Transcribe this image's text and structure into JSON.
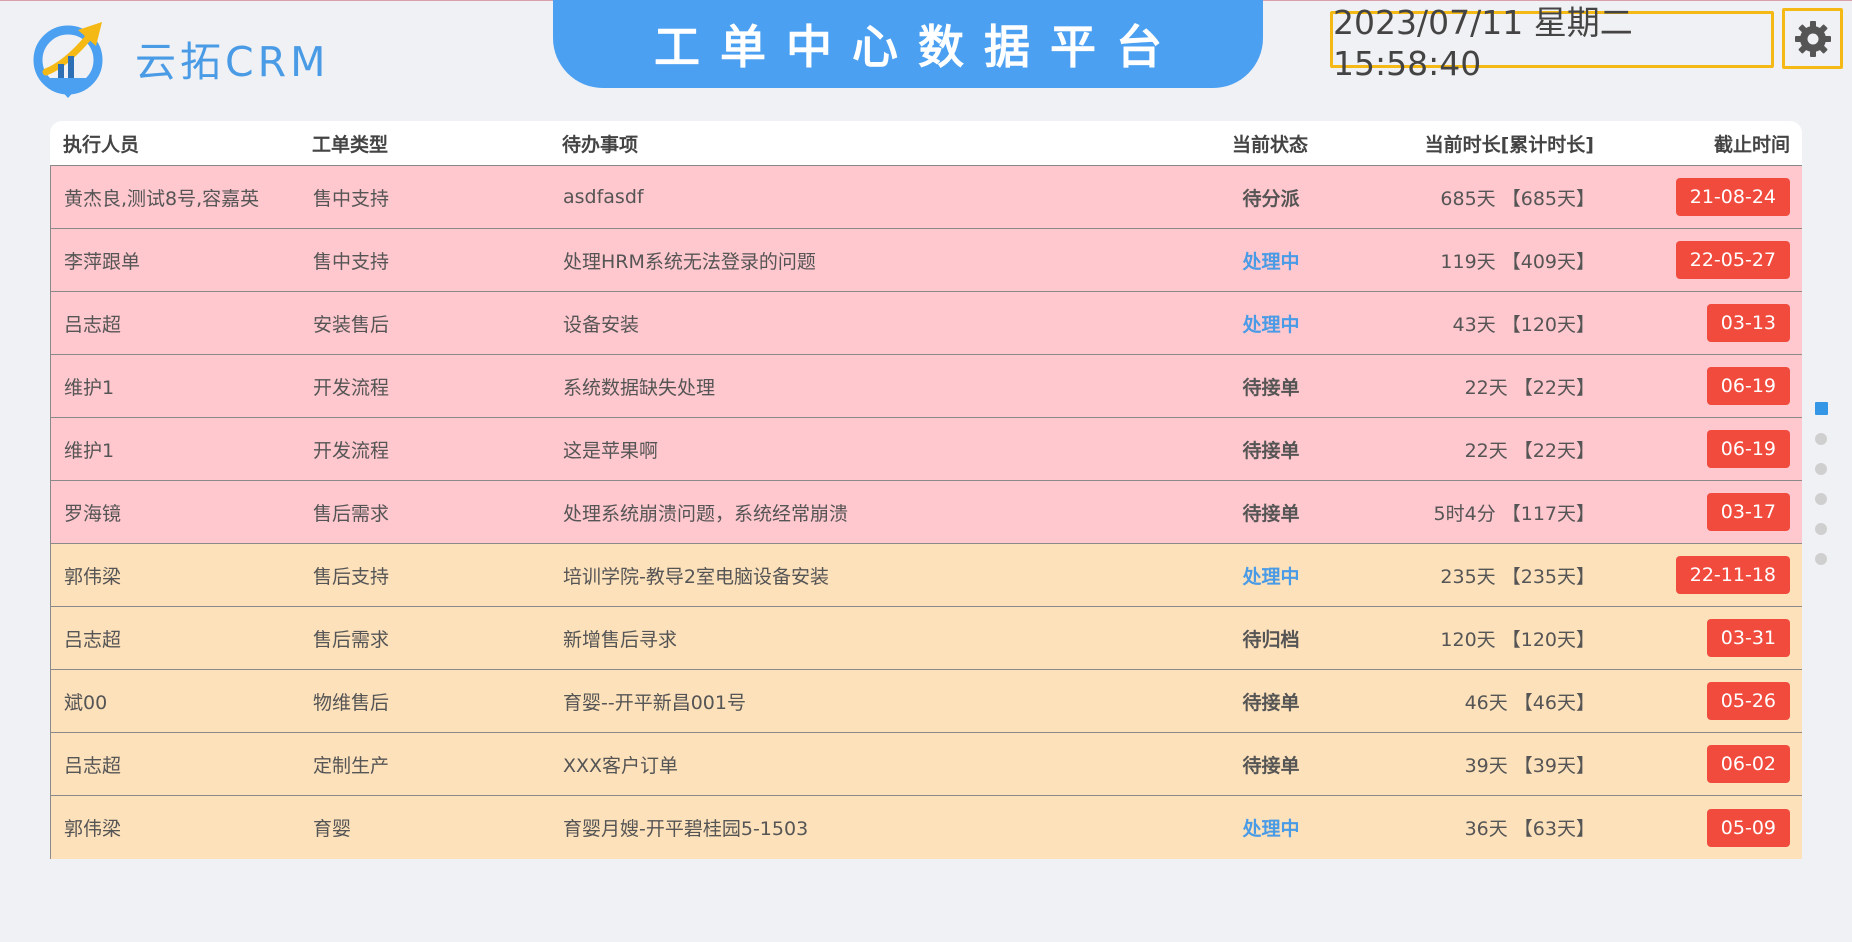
{
  "brand": {
    "name": "云拓CRM"
  },
  "header": {
    "title": "工单中心数据平台",
    "datetime": "2023/07/11 星期二 15:58:40"
  },
  "colors": {
    "accent": "#4ba0f1",
    "clock_border": "#f5b915",
    "row_pink": "#ffc8ce",
    "row_tan": "#fde1bb",
    "deadline_badge": "#f14b3e",
    "status_processing": "#4a9be6"
  },
  "icons": {
    "logo": "rocket-arrow-logo-icon",
    "settings": "gear-icon"
  },
  "table": {
    "columns": [
      "执行人员",
      "工单类型",
      "待办事项",
      "当前状态",
      "当前时长[累计时长]",
      "截止时间"
    ],
    "rows": [
      {
        "assignee": "黄杰良,测试8号,容嘉英",
        "type": "售中支持",
        "task": "asdfasdf",
        "status": "待分派",
        "status_kind": "waiting",
        "duration": "685天 【685天】",
        "deadline": "21-08-24",
        "tone": "pink"
      },
      {
        "assignee": "李萍跟单",
        "type": "售中支持",
        "task": "处理HRM系统无法登录的问题",
        "status": "处理中",
        "status_kind": "processing",
        "duration": "119天 【409天】",
        "deadline": "22-05-27",
        "tone": "pink"
      },
      {
        "assignee": "吕志超",
        "type": "安装售后",
        "task": "设备安装",
        "status": "处理中",
        "status_kind": "processing",
        "duration": "43天 【120天】",
        "deadline": "03-13",
        "tone": "pink"
      },
      {
        "assignee": "维护1",
        "type": "开发流程",
        "task": "系统数据缺失处理",
        "status": "待接单",
        "status_kind": "waiting",
        "duration": "22天 【22天】",
        "deadline": "06-19",
        "tone": "pink"
      },
      {
        "assignee": "维护1",
        "type": "开发流程",
        "task": "这是苹果啊",
        "status": "待接单",
        "status_kind": "waiting",
        "duration": "22天 【22天】",
        "deadline": "06-19",
        "tone": "pink"
      },
      {
        "assignee": "罗海镜",
        "type": "售后需求",
        "task": "处理系统崩溃问题，系统经常崩溃",
        "status": "待接单",
        "status_kind": "waiting",
        "duration": "5时4分 【117天】",
        "deadline": "03-17",
        "tone": "pink"
      },
      {
        "assignee": "郭伟梁",
        "type": "售后支持",
        "task": "培训学院-教导2室电脑设备安装",
        "status": "处理中",
        "status_kind": "processing",
        "duration": "235天 【235天】",
        "deadline": "22-11-18",
        "tone": "tan"
      },
      {
        "assignee": "吕志超",
        "type": "售后需求",
        "task": "新增售后寻求",
        "status": "待归档",
        "status_kind": "waiting",
        "duration": "120天 【120天】",
        "deadline": "03-31",
        "tone": "tan"
      },
      {
        "assignee": "斌00",
        "type": "物维售后",
        "task": "育婴--开平新昌001号",
        "status": "待接单",
        "status_kind": "waiting",
        "duration": "46天 【46天】",
        "deadline": "05-26",
        "tone": "tan"
      },
      {
        "assignee": "吕志超",
        "type": "定制生产",
        "task": "XXX客户订单",
        "status": "待接单",
        "status_kind": "waiting",
        "duration": "39天 【39天】",
        "deadline": "06-02",
        "tone": "tan"
      },
      {
        "assignee": "郭伟梁",
        "type": "育婴",
        "task": "育婴月嫂-开平碧桂园5-1503",
        "status": "处理中",
        "status_kind": "processing",
        "duration": "36天 【63天】",
        "deadline": "05-09",
        "tone": "tan"
      }
    ]
  },
  "pager": {
    "pages": 6,
    "active": 1
  }
}
